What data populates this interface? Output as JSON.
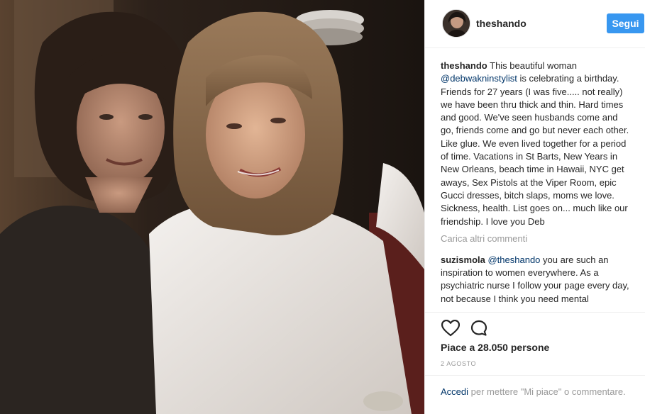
{
  "header": {
    "username": "theshando",
    "follow_label": "Segui"
  },
  "caption": {
    "username": "theshando",
    "text_before_mention": "This beautiful woman",
    "mention": "@debwakninstylist",
    "text_after_mention": "is celebrating a birthday. Friends for 27 years (I was five..... not really) we have been thru thick and thin. Hard times and good. We've seen husbands come and go, friends come and go but never each other. Like glue. We even lived together for a period of time. Vacations in St Barts, New Years in New Orleans, beach time in Hawaii, NYC get aways, Sex Pistols at the Viper Room, epic Gucci dresses, bitch slaps, moms we love. Sickness, health. List goes on... much like our friendship. I love you Deb"
  },
  "load_more_label": "Carica altri commenti",
  "comment": {
    "username": "suzismola",
    "mention": "@theshando",
    "text": "you are such an inspiration to women everywhere. As a psychiatric nurse I follow your page every day, not because I think you need mental"
  },
  "actions": {
    "like_icon": "heart-outline-icon",
    "comment_icon": "speech-bubble-icon"
  },
  "likes_text": "Piace a 28.050 persone",
  "date_text": "2 AGOSTO",
  "login": {
    "link_label": "Accedi",
    "text": "per mettere \"Mi piace\" o commentare."
  },
  "colors": {
    "accent_blue": "#3897f0",
    "link_blue": "#003569",
    "muted_gray": "#999999",
    "border_gray": "#efefef"
  }
}
